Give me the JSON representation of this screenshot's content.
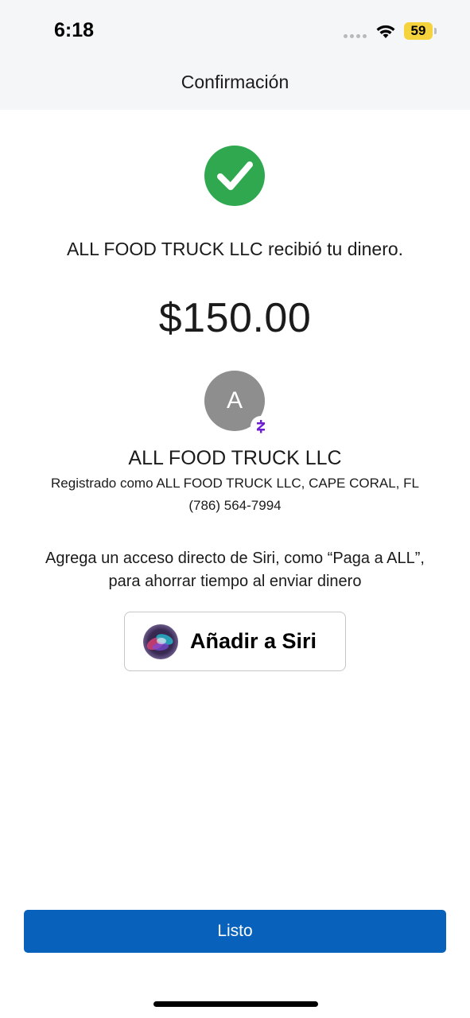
{
  "status_bar": {
    "time": "6:18",
    "battery_level": "59",
    "icons": [
      "signal-dots-icon",
      "wifi-icon",
      "battery-icon"
    ]
  },
  "header": {
    "title": "Confirmación"
  },
  "confirmation": {
    "icon": "checkmark-icon",
    "success_color": "#2fa84f",
    "message": "ALL FOOD TRUCK LLC recibió tu dinero.",
    "amount": "$150.00"
  },
  "payee": {
    "avatar_initial": "A",
    "badge_icon": "zelle-icon",
    "badge_color": "#6d1ed4",
    "name": "ALL FOOD TRUCK LLC",
    "registration": "Registrado como ALL FOOD TRUCK LLC, CAPE CORAL, FL",
    "phone": "(786) 564-7994"
  },
  "siri": {
    "hint_line1": "Agrega un acceso directo de Siri, como “Paga a ALL”,",
    "hint_line2": "para ahorrar tiempo al enviar dinero",
    "button_label": "Añadir a Siri",
    "icon": "siri-icon"
  },
  "footer": {
    "done_label": "Listo",
    "accent_color": "#0862bc"
  }
}
